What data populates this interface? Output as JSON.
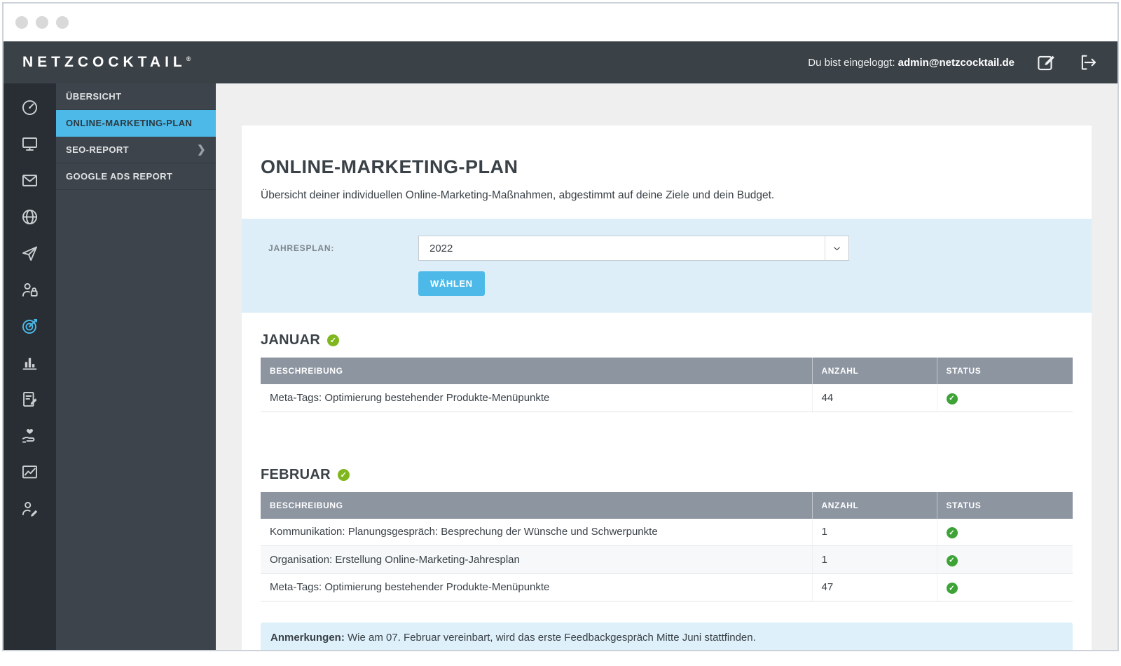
{
  "window": {
    "control_count": 3
  },
  "header": {
    "logo": "NETZCOCKTAIL",
    "logo_mark": "®",
    "login_prefix": "Du bist eingeloggt: ",
    "login_email": "admin@netzcocktail.de"
  },
  "sidebar": {
    "active_icon": "target-icon",
    "rail_icons": [
      "dashboard-icon",
      "monitor-icon",
      "mail-icon",
      "globe-icon",
      "send-icon",
      "user-lock-icon",
      "target-icon",
      "bar-chart-icon",
      "report-edit-icon",
      "care-icon",
      "image-chart-icon",
      "user-edit-icon"
    ],
    "menu": [
      {
        "label": "ÜBERSICHT",
        "active": false,
        "has_submenu": false
      },
      {
        "label": "ONLINE-MARKETING-PLAN",
        "active": true,
        "has_submenu": false
      },
      {
        "label": "SEO-REPORT",
        "active": false,
        "has_submenu": true
      },
      {
        "label": "GOOGLE ADS REPORT",
        "active": false,
        "has_submenu": false
      }
    ]
  },
  "main": {
    "title": "ONLINE-MARKETING-PLAN",
    "subtitle": "Übersicht deiner individuellen Online-Marketing-Maßnahmen, abgestimmt auf deine Ziele und dein Budget.",
    "filter": {
      "label": "JAHRESPLAN:",
      "selected": "2022",
      "button": "WÄHLEN"
    },
    "table_headers": [
      "BESCHREIBUNG",
      "ANZAHL",
      "STATUS"
    ],
    "months": [
      {
        "name": "JANUAR",
        "complete": true,
        "rows": [
          {
            "description": "Meta-Tags: Optimierung bestehender Produkte-Menüpunkte",
            "count": "44",
            "status": "done"
          }
        ]
      },
      {
        "name": "FEBRUAR",
        "complete": true,
        "rows": [
          {
            "description": "Kommunikation: Planungsgespräch: Besprechung der Wünsche und Schwerpunkte",
            "count": "1",
            "status": "done"
          },
          {
            "description": "Organisation: Erstellung Online-Marketing-Jahresplan",
            "count": "1",
            "status": "done"
          },
          {
            "description": "Meta-Tags: Optimierung bestehender Produkte-Menüpunkte",
            "count": "47",
            "status": "done"
          }
        ],
        "note_label": "Anmerkungen:",
        "note_text": " Wie am 07. Februar vereinbart, wird das erste Feedbackgespräch Mitte Juni stattfinden."
      }
    ]
  },
  "colors": {
    "accent_blue": "#4cb9e9",
    "header_dark": "#3a4147",
    "rail_dark": "#282e33",
    "menu_dark": "#3d444b",
    "table_header_gray": "#8d95a1",
    "panel_blue": "#ddeef8",
    "note_blue": "#def0fa",
    "month_badge_green": "#80b71e",
    "status_green": "#3da336",
    "text_ink": "#3a4147"
  }
}
